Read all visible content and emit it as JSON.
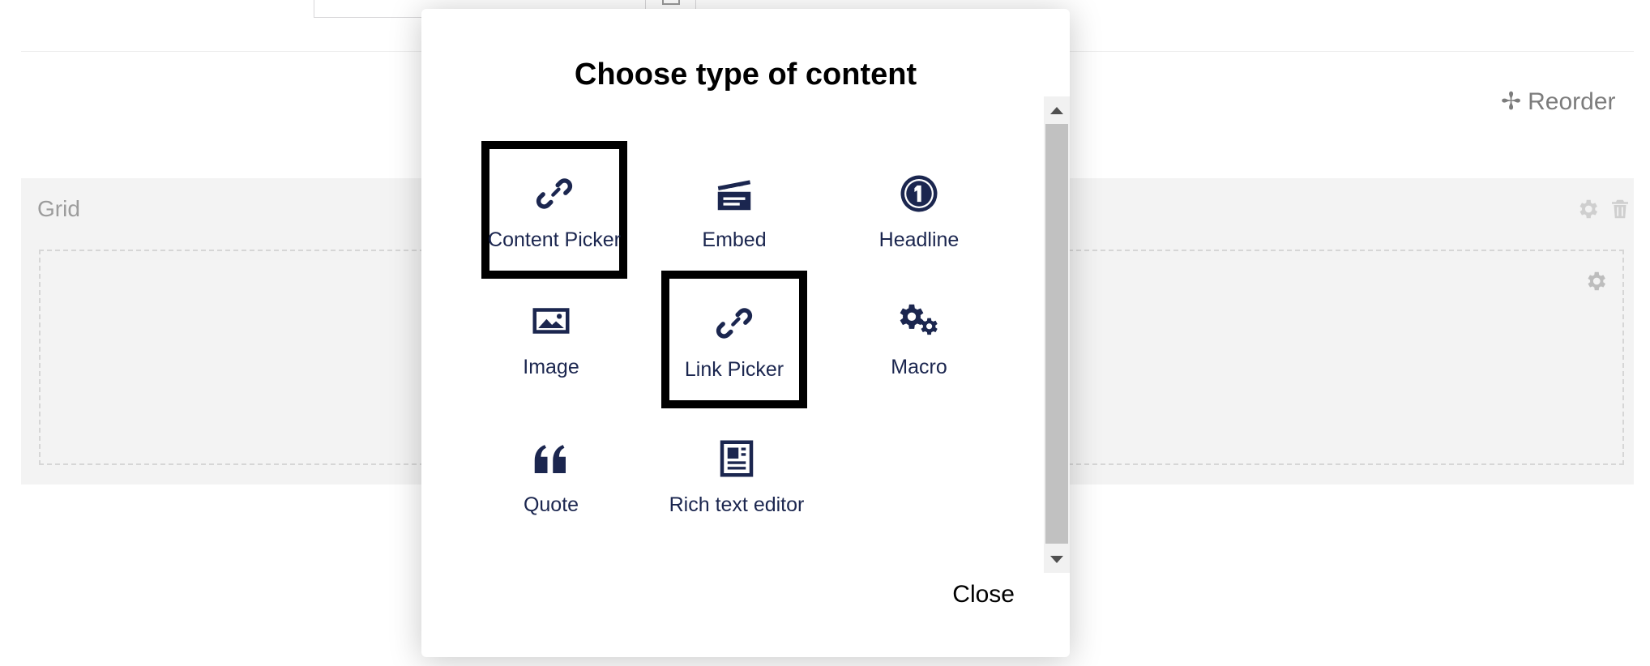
{
  "background": {
    "reorder_label": "Reorder",
    "grid_title": "Grid"
  },
  "modal": {
    "title": "Choose type of content",
    "close_label": "Close",
    "tiles": [
      {
        "label": "Content Picker",
        "icon": "link-icon",
        "selected": true
      },
      {
        "label": "Embed",
        "icon": "clapperboard-icon",
        "selected": false
      },
      {
        "label": "Headline",
        "icon": "number-one-icon",
        "selected": false
      },
      {
        "label": "Image",
        "icon": "picture-icon",
        "selected": false
      },
      {
        "label": "Link Picker",
        "icon": "link-icon",
        "selected": true
      },
      {
        "label": "Macro",
        "icon": "gears-icon",
        "selected": false
      },
      {
        "label": "Quote",
        "icon": "quote-icon",
        "selected": false
      },
      {
        "label": "Rich text editor",
        "icon": "document-icon",
        "selected": false
      }
    ]
  },
  "colors": {
    "icon": "#1b264f",
    "selection_border": "#000000",
    "panel_bg": "#f3f3f3"
  }
}
